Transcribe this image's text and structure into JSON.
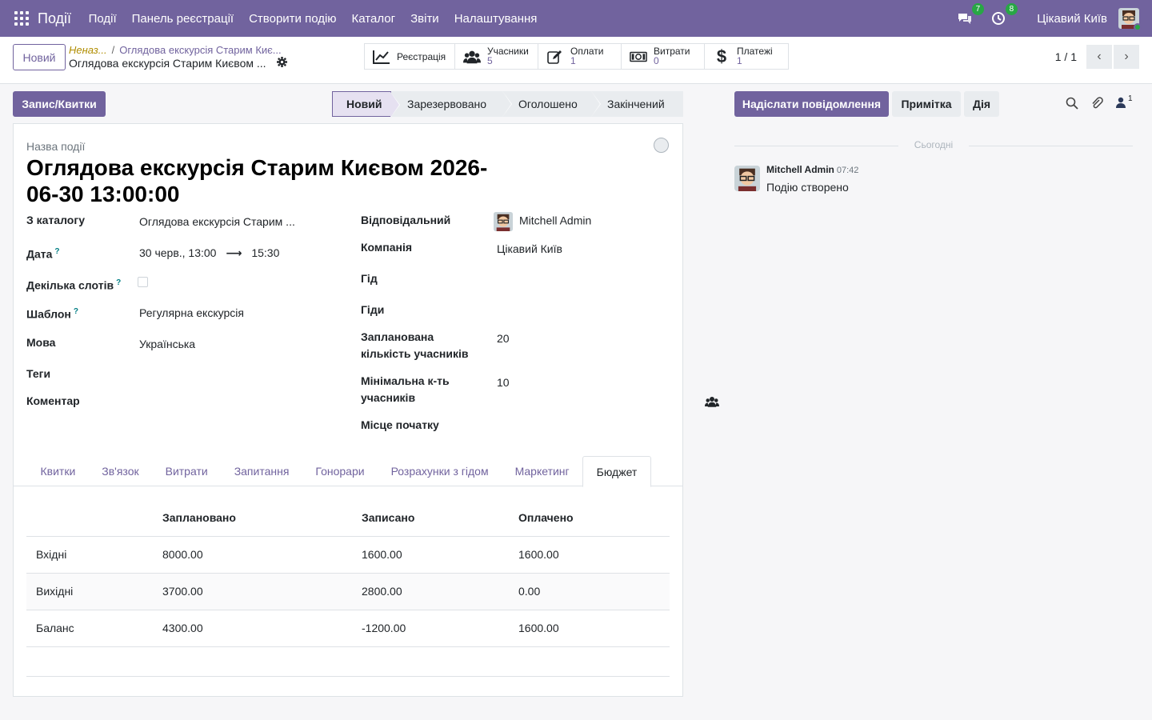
{
  "navbar": {
    "brand": "Події",
    "menu": [
      "Події",
      "Панель реєстрації",
      "Створити подію",
      "Каталог",
      "Звіти",
      "Налаштування"
    ],
    "messages_count": "7",
    "activities_count": "8",
    "company": "Цікавий Київ",
    "accent": "#71639e"
  },
  "control": {
    "new_label": "Новий",
    "breadcrumb_unsaved": "Неназ...",
    "breadcrumb_parent": "Оглядова екскурсія Старим Киє...",
    "breadcrumb_current": "Оглядова екскурсія Старим Києвом ...",
    "stats": [
      {
        "icon": "chart-line-icon",
        "label": "Реєстрація",
        "value": ""
      },
      {
        "icon": "users-icon",
        "label": "Учасники",
        "value": "5"
      },
      {
        "icon": "edit-icon",
        "label": "Оплати",
        "value": "1"
      },
      {
        "icon": "money-icon",
        "label": "Витрати",
        "value": "0"
      },
      {
        "icon": "dollar-icon",
        "label": "Платежі",
        "value": "1"
      }
    ],
    "pager": "1 / 1"
  },
  "statusbar": {
    "record_button": "Запис/Квитки",
    "stages": [
      "Новий",
      "Зарезервовано",
      "Оголошено",
      "Закінчений"
    ],
    "active_stage": "Новий"
  },
  "form": {
    "name_label": "Назва події",
    "title": "Оглядова екскурсія Старим Києвом 2026-06-30 13:00:00",
    "left": {
      "catalog_label": "З каталогу",
      "catalog_value": "Оглядова екскурсія Старим ...",
      "date_label": "Дата",
      "date_start": "30 черв., 13:00",
      "date_arrow": "⟶",
      "date_end": "15:30",
      "slots_label": "Декілька слотів",
      "template_label": "Шаблон",
      "template_value": "Регулярна екскурсія",
      "language_label": "Мова",
      "language_value": "Українська",
      "tags_label": "Теги",
      "comment_label": "Коментар"
    },
    "right": {
      "responsible_label": "Відповідальний",
      "responsible_value": "Mitchell Admin",
      "company_label": "Компанія",
      "company_value": "Цікавий Київ",
      "guide_label": "Гід",
      "guides_label": "Гіди",
      "planned_label": "Запланована кількість учасників",
      "planned_value": "20",
      "min_label": "Мінімальна к-ть учасників",
      "min_value": "10",
      "start_place_label": "Місце початку"
    },
    "help_mark": "?"
  },
  "tabs": [
    "Квитки",
    "Зв'язок",
    "Витрати",
    "Запитання",
    "Гонорари",
    "Розрахунки з гідом",
    "Маркетинг",
    "Бюджет"
  ],
  "active_tab": "Бюджет",
  "budget": {
    "headers": [
      "",
      "Заплановано",
      "Записано",
      "Оплачено"
    ],
    "rows": [
      [
        "Вхідні",
        "8000.00",
        "1600.00",
        "1600.00"
      ],
      [
        "Вихідні",
        "3700.00",
        "2800.00",
        "0.00"
      ],
      [
        "Баланс",
        "4300.00",
        "-1200.00",
        "1600.00"
      ]
    ]
  },
  "chatter": {
    "send_message": "Надіслати повідомлення",
    "note": "Примітка",
    "action": "Дія",
    "followers_count": "1",
    "today": "Сьогодні",
    "message": {
      "author": "Mitchell Admin",
      "time": "07:42",
      "body": "Подію створено"
    }
  }
}
